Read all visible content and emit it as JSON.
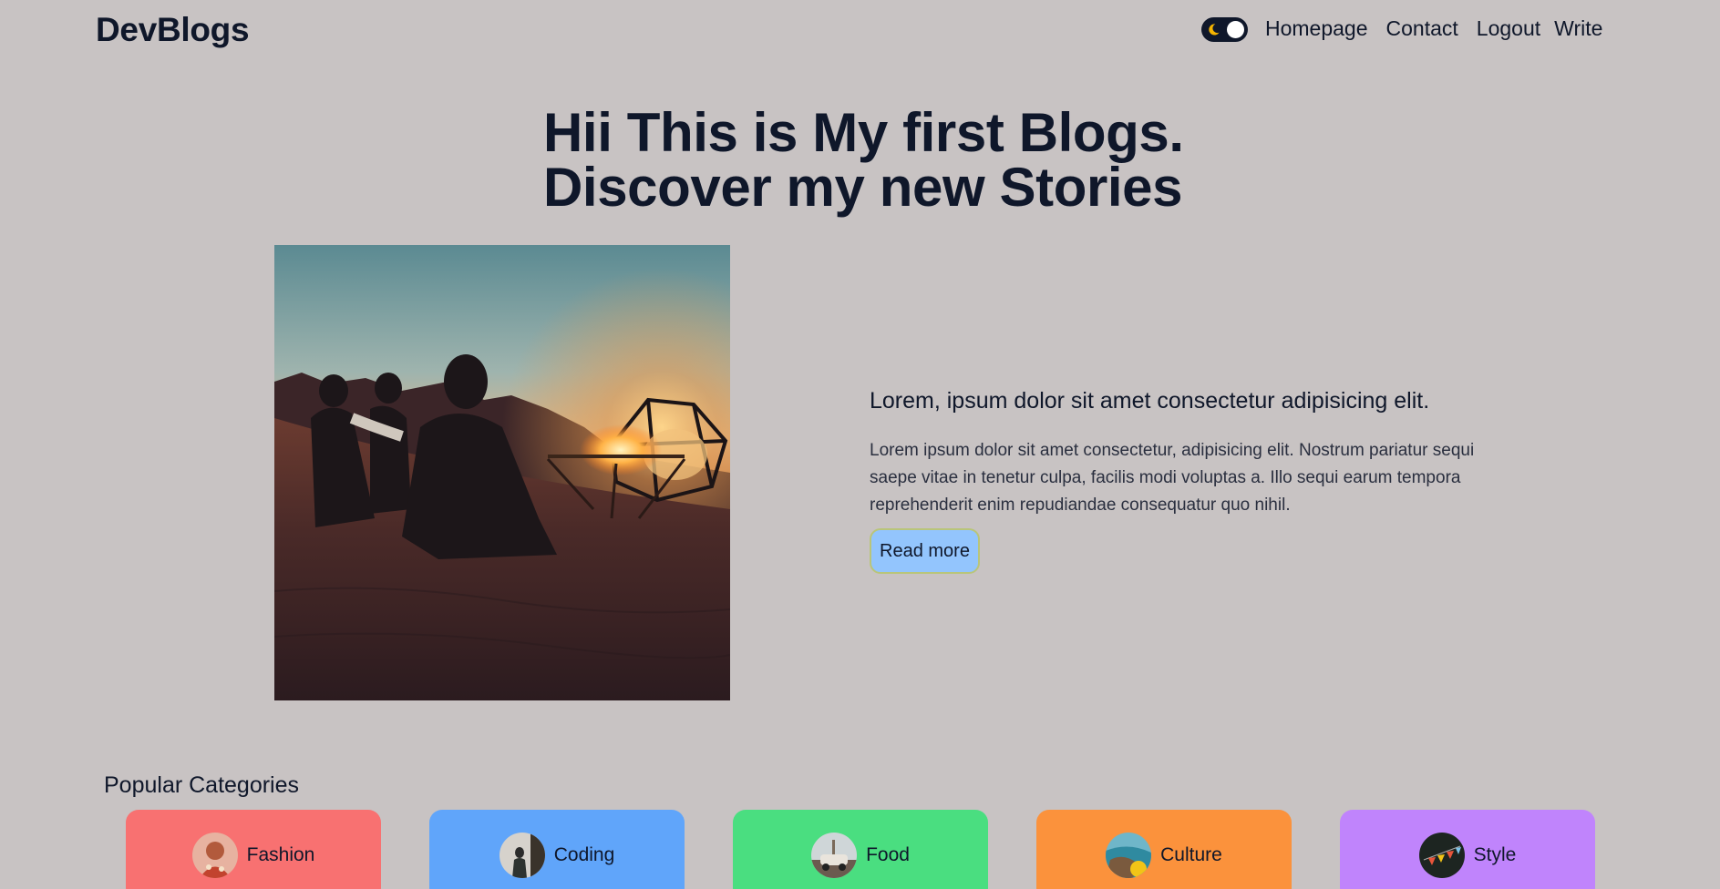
{
  "navbar": {
    "logo": "DevBlogs",
    "theme_toggle_icon": "moon-icon",
    "links": {
      "homepage": "Homepage",
      "contact": "Contact",
      "logout": "Logout",
      "write": "Write"
    }
  },
  "hero": {
    "title_line1": "Hii This is My first Blogs.",
    "title_line2": "Discover my new Stories"
  },
  "featured_post": {
    "image_alt": "people sitting by a campfire in the desert at dusk",
    "title": "Lorem, ipsum dolor sit amet consectetur adipisicing elit.",
    "description": "Lorem ipsum dolor sit amet consectetur, adipisicing elit. Nostrum pariatur sequi saepe vitae in tenetur culpa, facilis modi voluptas a. Illo sequi earum tempora reprehenderit enim repudiandae consequatur quo nihil.",
    "read_more": "Read more"
  },
  "categories": {
    "heading": "Popular Categories",
    "items": [
      {
        "label": "Fashion",
        "color": "#f87171"
      },
      {
        "label": "Coding",
        "color": "#60a5fa"
      },
      {
        "label": "Food",
        "color": "#4ade80"
      },
      {
        "label": "Culture",
        "color": "#fb923c"
      },
      {
        "label": "Style",
        "color": "#c084fc"
      }
    ]
  },
  "colors": {
    "background": "#c8c3c3",
    "text": "#0f172a",
    "button": "#93c5fd"
  }
}
